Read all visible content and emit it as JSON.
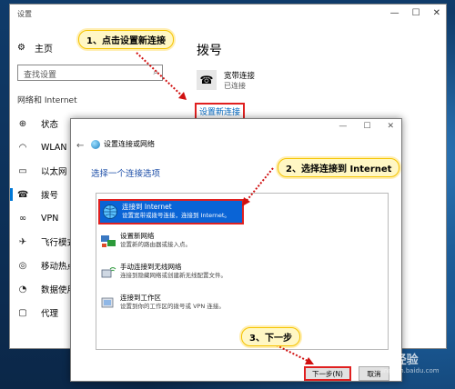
{
  "settings_window": {
    "title": "设置",
    "minimize_glyph": "—",
    "maximize_glyph": "☐",
    "close_glyph": "✕"
  },
  "sidebar": {
    "home_label": "主页",
    "search_placeholder": "查找设置",
    "section_label": "网络和 Internet",
    "items": [
      {
        "label": "状态",
        "icon": "globe-icon",
        "glyph": "⊕"
      },
      {
        "label": "WLAN",
        "icon": "wifi-icon",
        "glyph": "◠"
      },
      {
        "label": "以太网",
        "icon": "ethernet-icon",
        "glyph": "▭"
      },
      {
        "label": "拨号",
        "icon": "dialup-icon",
        "glyph": "☎"
      },
      {
        "label": "VPN",
        "icon": "vpn-icon",
        "glyph": "∞"
      },
      {
        "label": "飞行模式",
        "icon": "airplane-icon",
        "glyph": "✈"
      },
      {
        "label": "移动热点",
        "icon": "hotspot-icon",
        "glyph": "◎"
      },
      {
        "label": "数据使用量",
        "icon": "data-usage-icon",
        "glyph": "◔"
      },
      {
        "label": "代理",
        "icon": "proxy-icon",
        "glyph": "▢"
      }
    ],
    "active_index": 3
  },
  "content": {
    "page_title": "拨号",
    "connection_name": "宽带连接",
    "connection_status": "已连接",
    "setup_link": "设置新连接"
  },
  "dialog": {
    "title": "设置连接或网络",
    "heading": "选择一个连接选项",
    "options": [
      {
        "title": "连接到 Internet",
        "desc": "设置宽带或拨号连接，连接到 Internet。",
        "icon": "internet-globe-icon"
      },
      {
        "title": "设置新网络",
        "desc": "设置新的路由器或接入点。",
        "icon": "new-network-icon"
      },
      {
        "title": "手动连接到无线网络",
        "desc": "连接到隐藏网络或创建新无线配置文件。",
        "icon": "wireless-icon"
      },
      {
        "title": "连接到工作区",
        "desc": "设置到你的工作区的拨号或 VPN 连接。",
        "icon": "workplace-icon"
      }
    ],
    "selected_index": 0,
    "next_button": "下一步(N)",
    "cancel_button": "取消"
  },
  "annotations": {
    "step1": "1、点击设置新连接",
    "step2": "2、选择连接到 Internet",
    "step3": "3、下一步"
  },
  "watermark": {
    "brand": "Bai 经验",
    "url": "jingyan.baidu.com"
  },
  "colors": {
    "accent": "#0078d7",
    "selection": "#0a64d6",
    "highlight_border": "#e02020",
    "callout_bg": "#fff7c4"
  }
}
